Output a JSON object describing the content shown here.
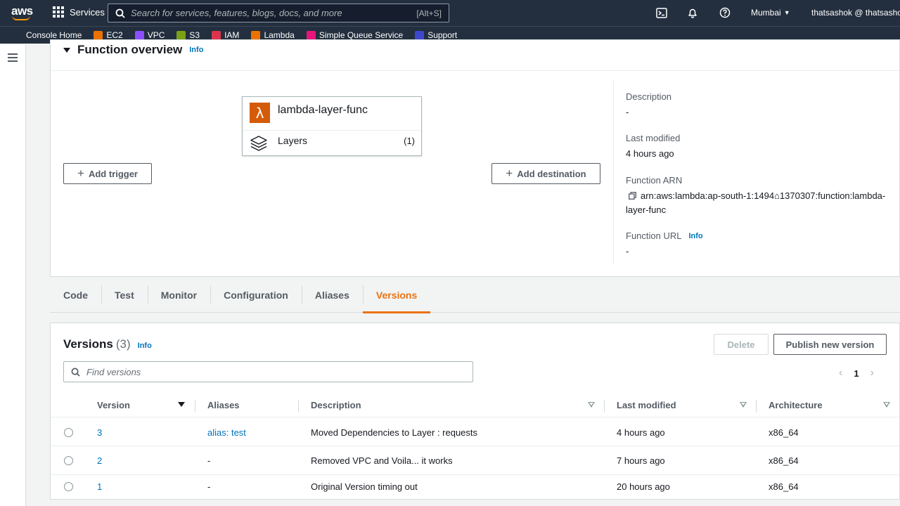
{
  "topnav": {
    "logo_text": "aws",
    "services_label": "Services",
    "search_placeholder": "Search for services, features, blogs, docs, and more",
    "search_shortcut": "[Alt+S]",
    "region": "Mumbai",
    "account": "thatsashok @ thatsashok"
  },
  "favorites": [
    {
      "label": "Console Home",
      "color": "#232f3e"
    },
    {
      "label": "EC2",
      "color": "#ed7100"
    },
    {
      "label": "VPC",
      "color": "#8c4fff"
    },
    {
      "label": "S3",
      "color": "#7aa116"
    },
    {
      "label": "IAM",
      "color": "#dd344c"
    },
    {
      "label": "Lambda",
      "color": "#ed7100"
    },
    {
      "label": "Simple Queue Service",
      "color": "#e7157b"
    },
    {
      "label": "Support",
      "color": "#3f48cc"
    }
  ],
  "overview": {
    "title": "Function overview",
    "info": "Info",
    "function_name": "lambda-layer-func",
    "layers_label": "Layers",
    "layers_count": "(1)",
    "add_trigger": "Add trigger",
    "add_destination": "Add destination",
    "description_label": "Description",
    "description_value": "-",
    "last_modified_label": "Last modified",
    "last_modified_value": "4 hours ago",
    "arn_label": "Function ARN",
    "arn_value": "arn:aws:lambda:ap-south-1:1494⌂1370307:function:lambda-layer-func",
    "url_label": "Function URL",
    "url_info": "Info",
    "url_value": "-"
  },
  "tabs": [
    "Code",
    "Test",
    "Monitor",
    "Configuration",
    "Aliases",
    "Versions"
  ],
  "active_tab": "Versions",
  "versions": {
    "title": "Versions",
    "count": "(3)",
    "info": "Info",
    "delete_label": "Delete",
    "publish_label": "Publish new version",
    "search_placeholder": "Find versions",
    "page": "1",
    "columns": [
      "Version",
      "Aliases",
      "Description",
      "Last modified",
      "Architecture"
    ],
    "rows": [
      {
        "version": "3",
        "alias": "alias: test",
        "description": "Moved Dependencies to Layer : requests",
        "modified": "4 hours ago",
        "arch": "x86_64"
      },
      {
        "version": "2",
        "alias": "-",
        "description": "Removed VPC and Voila... it works",
        "modified": "7 hours ago",
        "arch": "x86_64"
      },
      {
        "version": "1",
        "alias": "-",
        "description": "Original Version timing out",
        "modified": "20 hours ago",
        "arch": "x86_64"
      }
    ]
  },
  "colors": {
    "nav_bg": "#232f3e",
    "accent_orange": "#ec7211",
    "link_blue": "#0073bb"
  }
}
